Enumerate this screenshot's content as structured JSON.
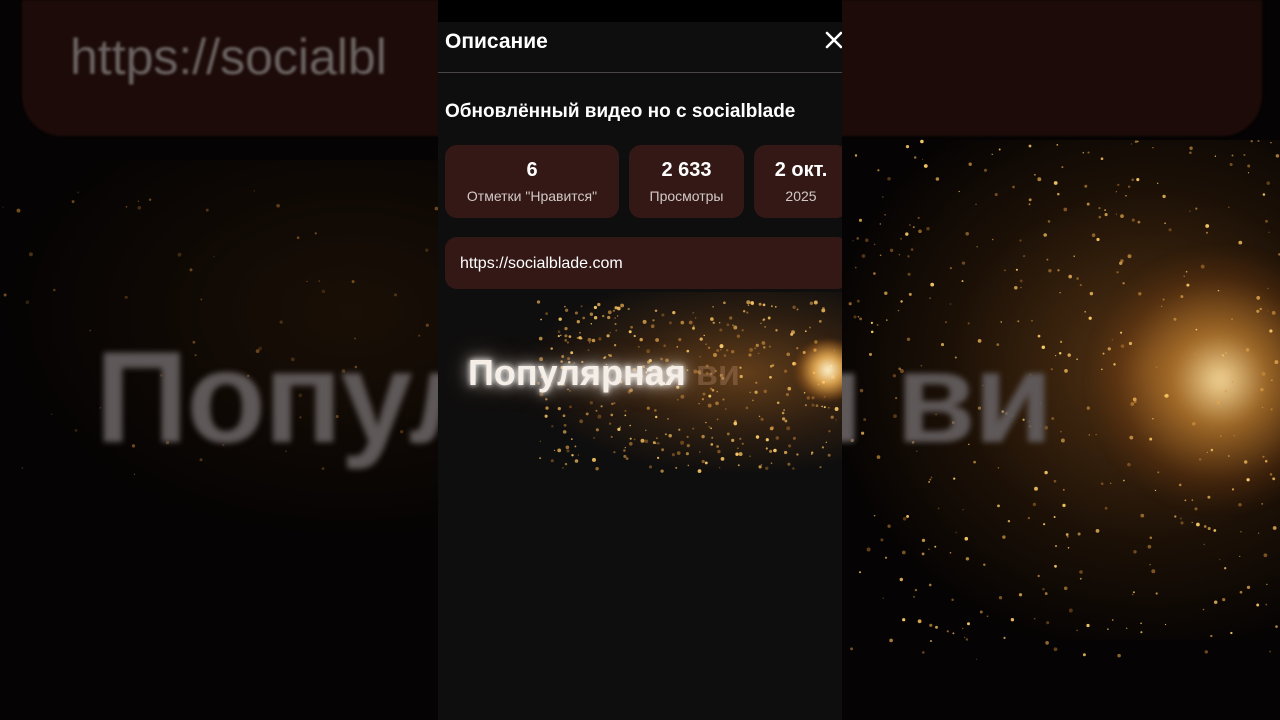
{
  "background": {
    "url_text": "https://socialbl",
    "big_text": "Популярная ви"
  },
  "panel": {
    "title": "Описание",
    "close_icon": "close-icon",
    "video_title": "Обновлённый видео но с socialblade",
    "stats": [
      {
        "value": "6",
        "label": "Отметки \"Нравится\""
      },
      {
        "value": "2 633",
        "label": "Просмотры"
      },
      {
        "value": "2 окт.",
        "label": "2025"
      }
    ],
    "link": "https://socialblade.com"
  },
  "video": {
    "text_bright": "Популярная",
    "text_faded": " ви"
  },
  "colors": {
    "card_bg": "#331816",
    "panel_bg": "#0f0e0e",
    "accent_spark": "#e89a3c"
  }
}
